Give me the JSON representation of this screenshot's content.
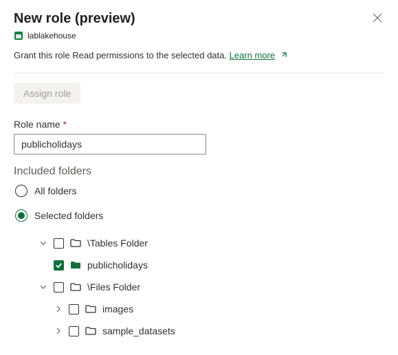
{
  "header": {
    "title": "New role (preview)",
    "lakehouse_name": "lablakehouse"
  },
  "description": {
    "text": "Grant this role Read permissions to the selected data. ",
    "learn_more": "Learn more"
  },
  "buttons": {
    "assign_role": "Assign role"
  },
  "form": {
    "role_name_label": "Role name",
    "role_name_value": "publicholidays",
    "included_folders_label": "Included folders",
    "radio_all": "All folders",
    "radio_selected": "Selected folders",
    "radio_choice": "selected"
  },
  "tree": {
    "nodes": [
      {
        "label": "\\Tables Folder",
        "expanded": true,
        "checked": false,
        "children_labels": [
          "publicholidays"
        ]
      },
      {
        "label": "\\Files Folder",
        "expanded": true,
        "checked": false,
        "children_labels": [
          "images",
          "sample_datasets"
        ]
      }
    ],
    "tables_folder": "\\Tables Folder",
    "publicholidays": "publicholidays",
    "files_folder": "\\Files Folder",
    "images": "images",
    "sample_datasets": "sample_datasets"
  }
}
